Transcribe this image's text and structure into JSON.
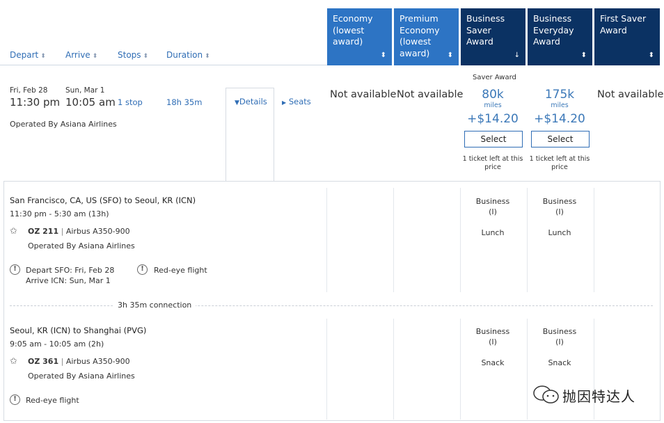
{
  "sort_headers": [
    {
      "label": "Depart"
    },
    {
      "label": "Arrive"
    },
    {
      "label": "Stops"
    },
    {
      "label": "Duration"
    }
  ],
  "fare_columns": [
    {
      "label": "Economy (lowest award)",
      "icon": "sort-icon"
    },
    {
      "label": "Premium Economy (lowest award)",
      "icon": "sort-icon"
    },
    {
      "label": "Business Saver Award",
      "icon": "sort-desc-icon"
    },
    {
      "label": "Business Everyday Award",
      "icon": "sort-icon"
    },
    {
      "label": "First Saver Award",
      "icon": "sort-icon"
    }
  ],
  "flight": {
    "depart_date": "Fri, Feb 28",
    "depart_time": "11:30 pm",
    "arrive_date": "Sun, Mar 1",
    "arrive_time": "10:05 am",
    "stops": "1 stop",
    "duration": "18h 35m",
    "operated_by": "Operated By Asiana Airlines",
    "details_label": "Details",
    "seats_label": "Seats"
  },
  "fares": {
    "economy": "Not available",
    "premium": "Not available",
    "saver_label": "Saver Award",
    "business_saver": {
      "miles": "80k",
      "miles_unit": "miles",
      "price": "+$14.20",
      "select": "Select",
      "note": "1 ticket left at this price"
    },
    "business_everyday": {
      "miles": "175k",
      "miles_unit": "miles",
      "price": "+$14.20",
      "select": "Select",
      "note": "1 ticket left at this price"
    },
    "first": "Not available"
  },
  "segments": [
    {
      "route": "San Francisco, CA, US (SFO) to Seoul, KR (ICN)",
      "times": "11:30 pm - 5:30 am (13h)",
      "flight_no": "OZ 211",
      "aircraft": "Airbus A350-900",
      "operated_by": "Operated By Asiana Airlines",
      "notice_depart": "Depart SFO: Fri, Feb 28",
      "notice_arrive": "Arrive ICN: Sun, Mar 1",
      "notice_redeye": "Red-eye flight",
      "cabin": "Business",
      "cabin_code": "(I)",
      "meal": "Lunch"
    },
    {
      "route": "Seoul, KR (ICN) to Shanghai (PVG)",
      "times": "9:05 am - 10:05 am (2h)",
      "flight_no": "OZ 361",
      "aircraft": "Airbus A350-900",
      "operated_by": "Operated By Asiana Airlines",
      "notice_redeye": "Red-eye flight",
      "cabin": "Business",
      "cabin_code": "(I)",
      "meal": "Snack"
    }
  ],
  "connection": "3h 35m connection",
  "separator": "|",
  "glyphs": {
    "sort": "⬍",
    "sort_desc": "↓",
    "caret_down": "▼",
    "caret_right": "▶",
    "alert": "!"
  },
  "watermark": "抛因特达人",
  "colors": {
    "header_light": "#2d74c4",
    "header_dark": "#0b3263",
    "link": "#2f6db5",
    "miles": "#3b78b8"
  }
}
